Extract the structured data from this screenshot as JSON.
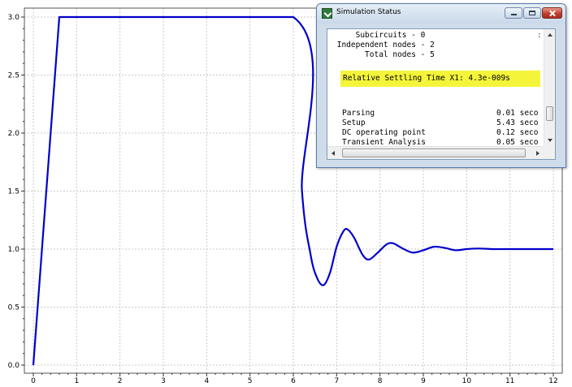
{
  "chart_data": {
    "type": "line",
    "title": "",
    "xlabel": "",
    "ylabel": "",
    "xlim": [
      0,
      12
    ],
    "ylim": [
      0,
      3
    ],
    "x_ticks": [
      "0",
      "1",
      "2",
      "3",
      "4",
      "5",
      "6",
      "7",
      "8",
      "9",
      "10",
      "11",
      "12"
    ],
    "y_ticks": [
      "0.0",
      "0.5",
      "1.0",
      "1.5",
      "2.0",
      "2.5",
      "3.0"
    ],
    "grid": true,
    "series": [
      {
        "color": "#0000cc",
        "x": [
          0,
          0.6,
          6.0,
          6.2,
          6.4,
          6.55,
          6.7,
          6.85,
          7.0,
          7.15,
          7.25,
          7.4,
          7.6,
          7.75,
          7.95,
          8.15,
          8.3,
          8.5,
          8.75,
          9.0,
          9.25,
          9.5,
          9.75,
          10.0,
          10.3,
          10.6,
          11.0,
          11.5,
          12.0
        ],
        "y": [
          0,
          3.0,
          3.0,
          1.5,
          0.95,
          0.75,
          0.69,
          0.8,
          1.02,
          1.15,
          1.17,
          1.1,
          0.95,
          0.91,
          0.97,
          1.04,
          1.05,
          1.01,
          0.97,
          0.99,
          1.02,
          1.01,
          0.99,
          1.0,
          1.005,
          1.0,
          1.0,
          1.0,
          1.0
        ]
      }
    ]
  },
  "window": {
    "title": "Simulation Status",
    "lines": [
      "     Subcircuits - 0",
      " Independent nodes - 2",
      "       Total nodes - 5"
    ],
    "highlight": "Relative Settling Time X1: 4.3e-009s",
    "timing": [
      {
        "label": "Parsing",
        "value": "0.01 seco"
      },
      {
        "label": "Setup",
        "value": "5.43 seco"
      },
      {
        "label": "DC operating point",
        "value": "0.12 seco"
      },
      {
        "label": "Transient Analysis",
        "value": "0.05 seco"
      }
    ],
    "clipped_char": ":"
  }
}
